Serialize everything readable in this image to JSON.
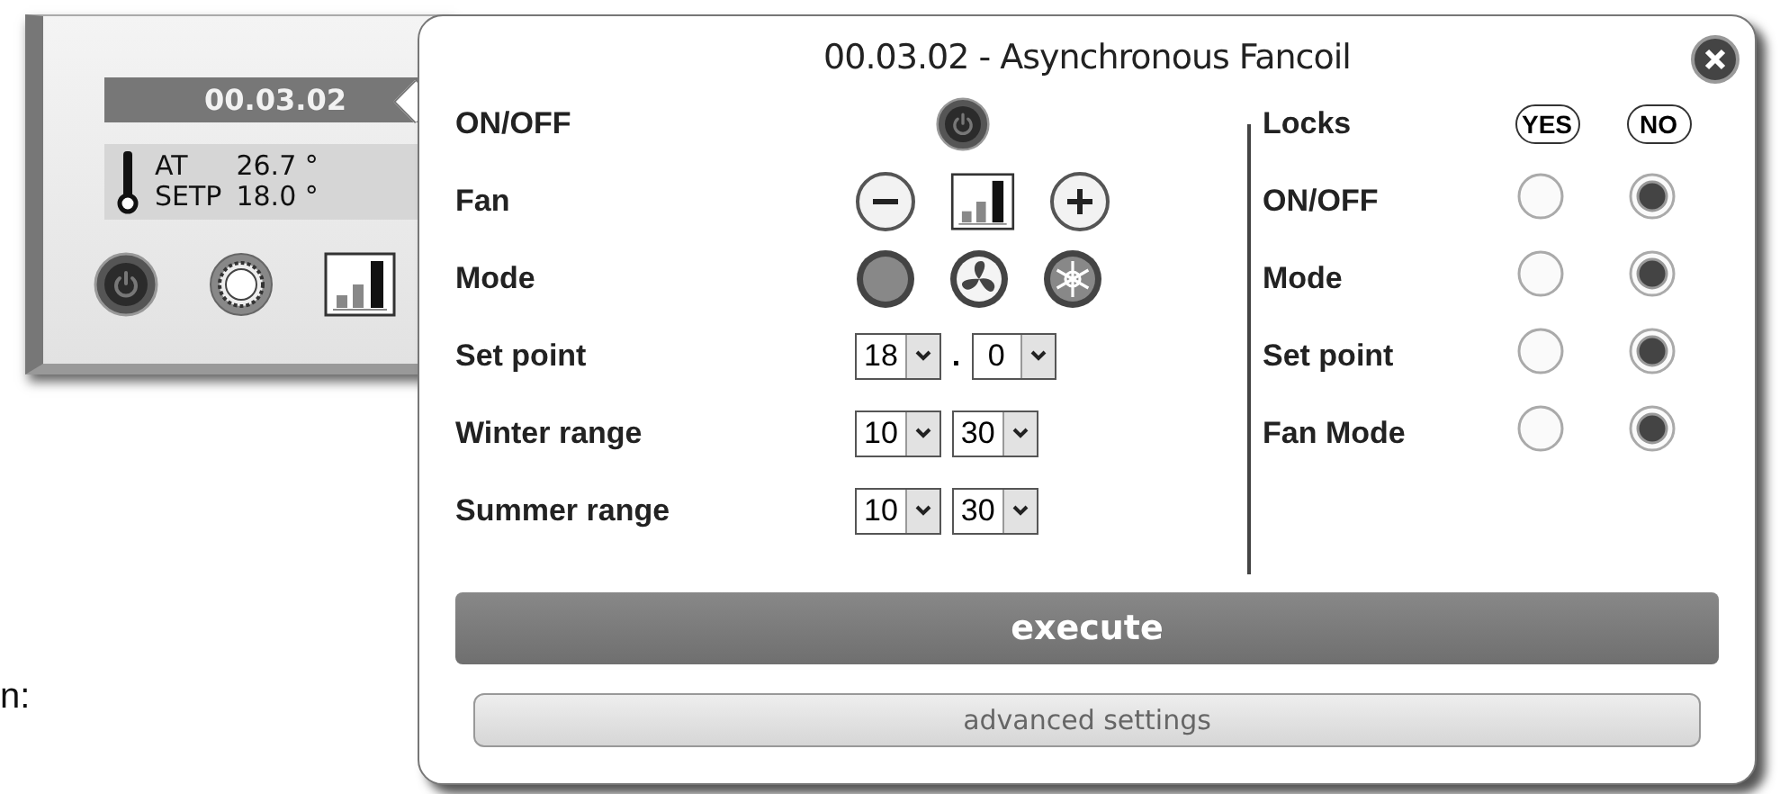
{
  "device_card": {
    "address": "00.03.02",
    "readings": [
      {
        "label": "AT",
        "value": "26.7 °"
      },
      {
        "label": "SETP",
        "value": "18.0 °"
      }
    ],
    "buttons": [
      {
        "kind": "power"
      },
      {
        "kind": "ring"
      },
      {
        "kind": "fan"
      }
    ]
  },
  "caption": "n:",
  "popup": {
    "title": "00.03.02 - Asynchronous Fancoil",
    "controls": [
      {
        "label": "ON/OFF",
        "kind": "power"
      },
      {
        "label": "Fan",
        "kind": "fan"
      },
      {
        "label": "Mode",
        "kind": "mode"
      },
      {
        "label": "Set point",
        "kind": "select",
        "values": [
          "18",
          "0"
        ],
        "separator": "."
      },
      {
        "label": "Winter range",
        "kind": "select",
        "values": [
          "10",
          "30"
        ]
      },
      {
        "label": "Summer range",
        "kind": "select",
        "values": [
          "10",
          "30"
        ]
      }
    ],
    "locks": {
      "heading": "Locks",
      "yes": "YES",
      "no": "NO",
      "items": [
        {
          "label": "ON/OFF",
          "locked": false
        },
        {
          "label": "Mode",
          "locked": false
        },
        {
          "label": "Set point",
          "locked": false
        },
        {
          "label": "Fan Mode",
          "locked": false
        }
      ]
    },
    "execute": "execute",
    "advanced": "advanced settings"
  }
}
